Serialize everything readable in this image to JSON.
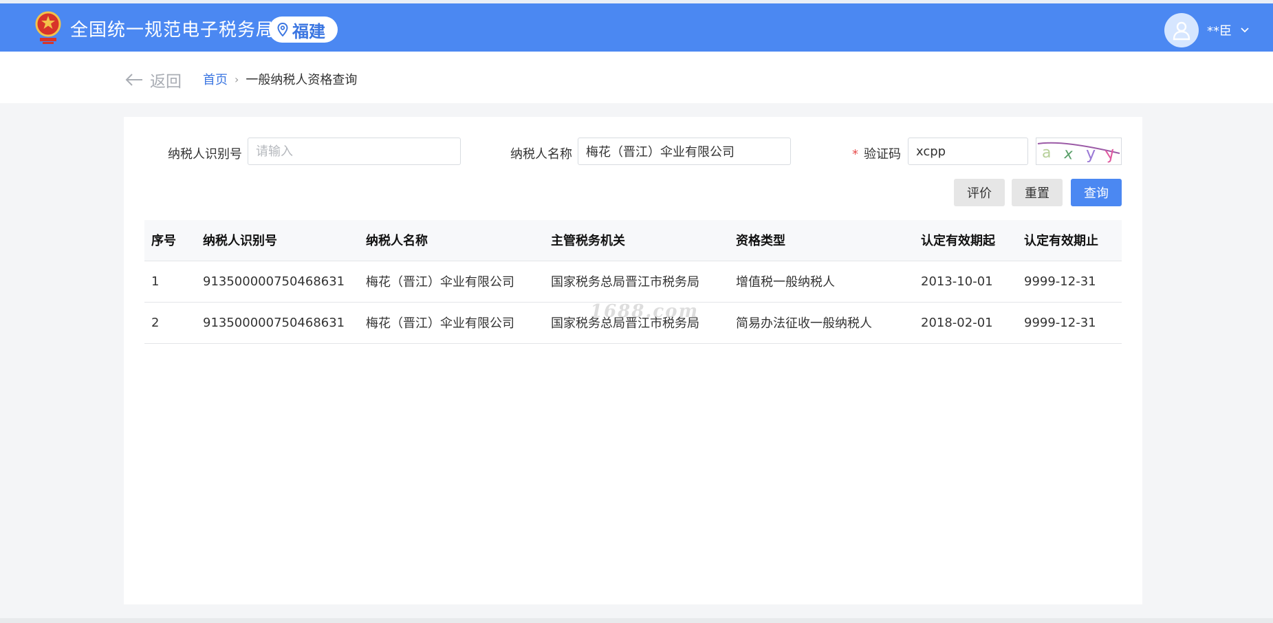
{
  "header": {
    "site_title": "全国统一规范电子税务局",
    "region": "福建",
    "user_name": "**臣"
  },
  "breadcrumb": {
    "back_label": "返回",
    "home": "首页",
    "separator": "›",
    "current": "一般纳税人资格查询"
  },
  "form": {
    "taxpayer_id_label": "纳税人识别号",
    "taxpayer_id_placeholder": "请输入",
    "taxpayer_id_value": "",
    "taxpayer_name_label": "纳税人名称",
    "taxpayer_name_value": "梅花（晋江）伞业有限公司",
    "captcha_required": "*",
    "captcha_label": "验证码",
    "captcha_value": "xcpp",
    "captcha_image_text": "axyy"
  },
  "buttons": {
    "evaluate": "评价",
    "reset": "重置",
    "query": "查询"
  },
  "table": {
    "columns": [
      "序号",
      "纳税人识别号",
      "纳税人名称",
      "主管税务机关",
      "资格类型",
      "认定有效期起",
      "认定有效期止"
    ],
    "rows": [
      [
        "1",
        "913500000750468631",
        "梅花（晋江）伞业有限公司",
        "国家税务总局晋江市税务局",
        "增值税一般纳税人",
        "2013-10-01",
        "9999-12-31"
      ],
      [
        "2",
        "913500000750468631",
        "梅花（晋江）伞业有限公司",
        "国家税务总局晋江市税务局",
        "简易办法征收一般纳税人",
        "2018-02-01",
        "9999-12-31"
      ]
    ]
  },
  "watermark": "1688.com",
  "colors": {
    "header_blue": "#4b88f2",
    "primary_blue": "#3b76e1",
    "required_red": "#e64b4b"
  }
}
